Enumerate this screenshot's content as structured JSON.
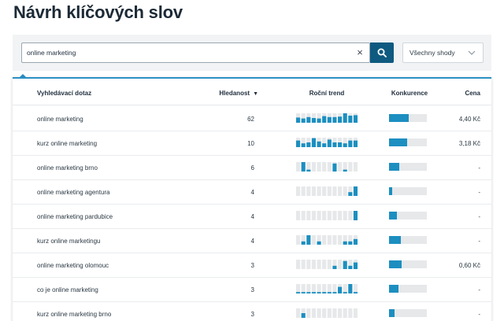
{
  "title": "Návrh klíčových slov",
  "search": {
    "value": "online marketing",
    "placeholder": ""
  },
  "match_select": {
    "selected": "Všechny shody"
  },
  "table": {
    "columns": {
      "query": "Vyhledávací dotaz",
      "volume": "Hledanost",
      "trend": "Roční trend",
      "competition": "Konkurence",
      "price": "Cena"
    },
    "rows": [
      {
        "query": "online marketing",
        "volume": "62",
        "competition": 0.52,
        "price": "4,40 Kč",
        "trend": [
          0.55,
          0.45,
          0.6,
          0.5,
          0.45,
          0.7,
          0.6,
          0.6,
          0.65,
          1.0,
          0.75,
          0.8
        ]
      },
      {
        "query": "kurz online marketing",
        "volume": "10",
        "competition": 0.48,
        "price": "3,18 Kč",
        "trend": [
          0.7,
          0.4,
          0.5,
          0.95,
          0.6,
          0.4,
          0.8,
          0.5,
          0.5,
          0.4,
          0.7,
          0.7
        ]
      },
      {
        "query": "online marketing brno",
        "volume": "6",
        "competition": 0.28,
        "price": "-",
        "trend": [
          0.0,
          1.0,
          0.2,
          0.0,
          0.0,
          0.0,
          0.0,
          0.85,
          0.0,
          0.2,
          0.0,
          0.0
        ]
      },
      {
        "query": "online marketing agentura",
        "volume": "4",
        "competition": 0.08,
        "price": "-",
        "trend": [
          0.0,
          0.0,
          0.0,
          0.0,
          0.0,
          0.0,
          0.0,
          0.0,
          0.0,
          0.0,
          0.4,
          1.0
        ]
      },
      {
        "query": "online marketing pardubice",
        "volume": "4",
        "competition": 0.2,
        "price": "-",
        "trend": [
          0.0,
          0.0,
          0.0,
          0.0,
          0.0,
          0.0,
          0.0,
          0.0,
          0.0,
          0.0,
          0.0,
          1.0
        ]
      },
      {
        "query": "kurz online marketingu",
        "volume": "4",
        "competition": 0.32,
        "price": "-",
        "trend": [
          0.0,
          0.35,
          1.0,
          0.0,
          0.35,
          0.0,
          0.0,
          0.0,
          0.0,
          0.35,
          0.35,
          0.6
        ]
      },
      {
        "query": "online marketing olomouc",
        "volume": "3",
        "competition": 0.33,
        "price": "0,60 Kč",
        "trend": [
          0.0,
          0.0,
          0.0,
          0.0,
          0.0,
          0.0,
          0.0,
          0.35,
          0.0,
          0.85,
          0.35,
          0.7
        ]
      },
      {
        "query": "co je online marketing",
        "volume": "3",
        "competition": 0.25,
        "price": "-",
        "trend": [
          0.15,
          0.15,
          0.15,
          0.15,
          0.15,
          0.15,
          0.15,
          0.15,
          0.7,
          0.15,
          1.0,
          0.15
        ]
      },
      {
        "query": "kurz online marketing brno",
        "volume": "3",
        "competition": 0.15,
        "price": "-",
        "trend": [
          0.0,
          0.5,
          0.0,
          0.0,
          0.0,
          0.0,
          0.0,
          0.0,
          0.0,
          0.0,
          0.0,
          0.0
        ]
      }
    ]
  },
  "colors": {
    "accent": "#1c8fc0",
    "button": "#0f5a80",
    "bar_bg": "#e6e8ea"
  },
  "icons": {
    "clear": "close-icon",
    "search": "search-icon",
    "select": "chevron-down-icon",
    "sort": "sort-down-icon"
  }
}
